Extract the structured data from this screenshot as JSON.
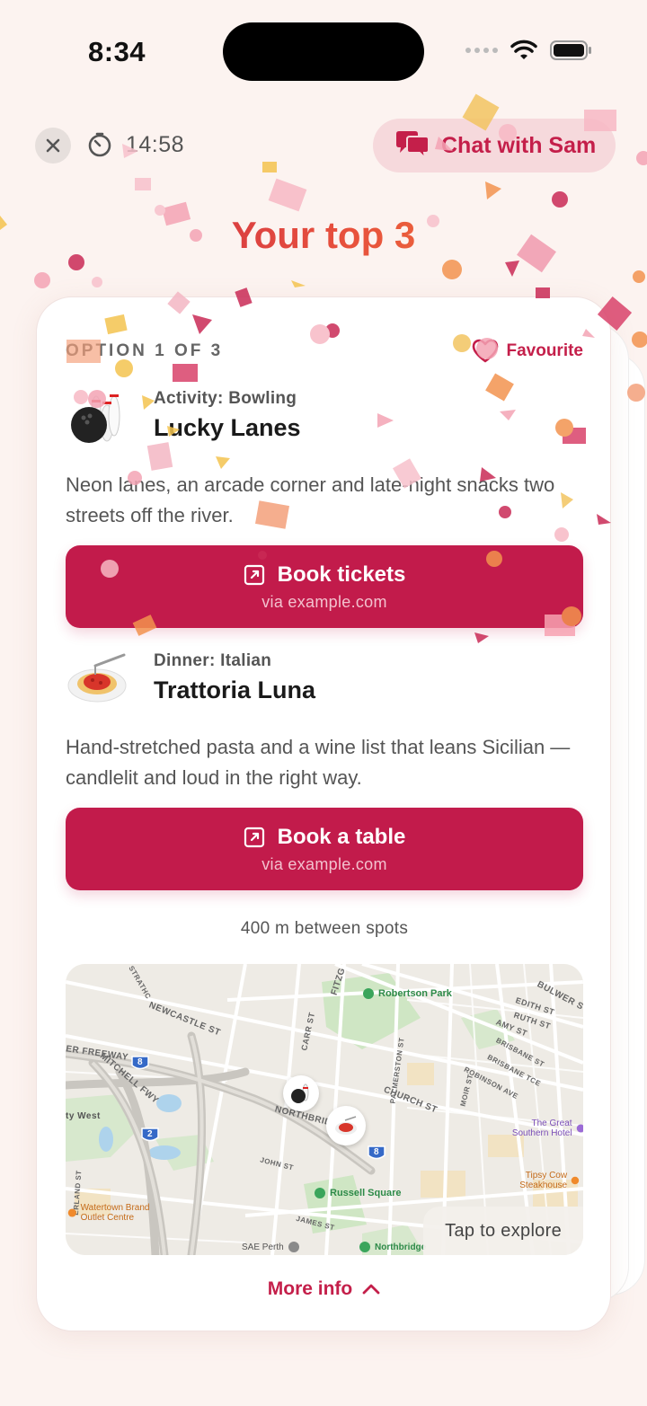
{
  "status_bar": {
    "time": "8:34"
  },
  "topbar": {
    "timer": "14:58",
    "chat_label": "Chat with Sam"
  },
  "page_title": "Your top 3",
  "card": {
    "option_label": "OPTION 1 OF 3",
    "favourite_label": "Favourite",
    "venues": [
      {
        "category": "Activity: Bowling",
        "name": "Lucky Lanes",
        "description": "Neon lanes, an arcade corner and late-night snacks two streets off the river.",
        "button_label": "Book tickets",
        "button_sub": "via example.com",
        "icon": "bowling-icon"
      },
      {
        "category": "Dinner: Italian",
        "name": "Trattoria Luna",
        "description": "Hand-stretched pasta and a wine list that leans Sicilian — candlelit and loud in the right way.",
        "button_label": "Book a table",
        "button_sub": "via example.com",
        "icon": "spaghetti-icon"
      }
    ],
    "distance": "400 m between spots",
    "map": {
      "tap_label": "Tap to explore",
      "streets": [
        "NEWCASTLE ST",
        "STRATHC",
        "CHURCH ST",
        "FITZG",
        "CARR ST",
        "EDITH ST",
        "RUTH ST",
        "AMY ST",
        "BULWER S",
        "BRISBANE ST",
        "BRISBANE TCE",
        "ROBINSON AVE",
        "MOIR ST",
        "PALMERSTON ST",
        "JOHN ST",
        "JAMES ST",
        "NORTHBRID",
        "MITCHELL FWY",
        "ER FREEWAY",
        "ERLAND ST"
      ],
      "places": [
        "Robertson Park",
        "The Great Southern Hotel",
        "Tipsy Cow Steakhouse",
        "Russell Square",
        "Watertown Brand Outlet Centre",
        "SAE Perth",
        "Northbridge",
        "ty West"
      ],
      "shields": [
        "8",
        "2",
        "8"
      ]
    },
    "more_info": "More info"
  },
  "colors": {
    "accent": "#c21b4b",
    "background": "#fcf3f0",
    "chip": "#f6d9dc"
  }
}
